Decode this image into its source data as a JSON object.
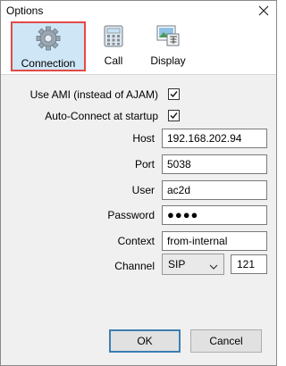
{
  "window": {
    "title": "Options",
    "close_icon": "close-icon"
  },
  "toolbar": {
    "items": [
      {
        "label": "Connection",
        "icon": "gear-icon",
        "active": true
      },
      {
        "label": "Call",
        "icon": "calculator-icon",
        "active": false
      },
      {
        "label": "Display",
        "icon": "display-icon",
        "active": false
      }
    ]
  },
  "options": {
    "use_ami": {
      "label": "Use AMI (instead of AJAM)",
      "checked": true
    },
    "auto_connect": {
      "label": "Auto-Connect at startup",
      "checked": true
    }
  },
  "fields": {
    "host": {
      "label": "Host",
      "value": "192.168.202.94"
    },
    "port": {
      "label": "Port",
      "value": "5038"
    },
    "user": {
      "label": "User",
      "value": "ac2d"
    },
    "password": {
      "label": "Password",
      "value": "●●●●"
    },
    "context": {
      "label": "Context",
      "value": "from-internal"
    },
    "channel": {
      "label": "Channel",
      "type_value": "SIP",
      "extension": "121"
    }
  },
  "buttons": {
    "ok": "OK",
    "cancel": "Cancel"
  },
  "colors": {
    "active_tab_border": "#e24a46",
    "active_tab_fill": "#cfe6f7",
    "default_button_border": "#3c7fb1"
  }
}
